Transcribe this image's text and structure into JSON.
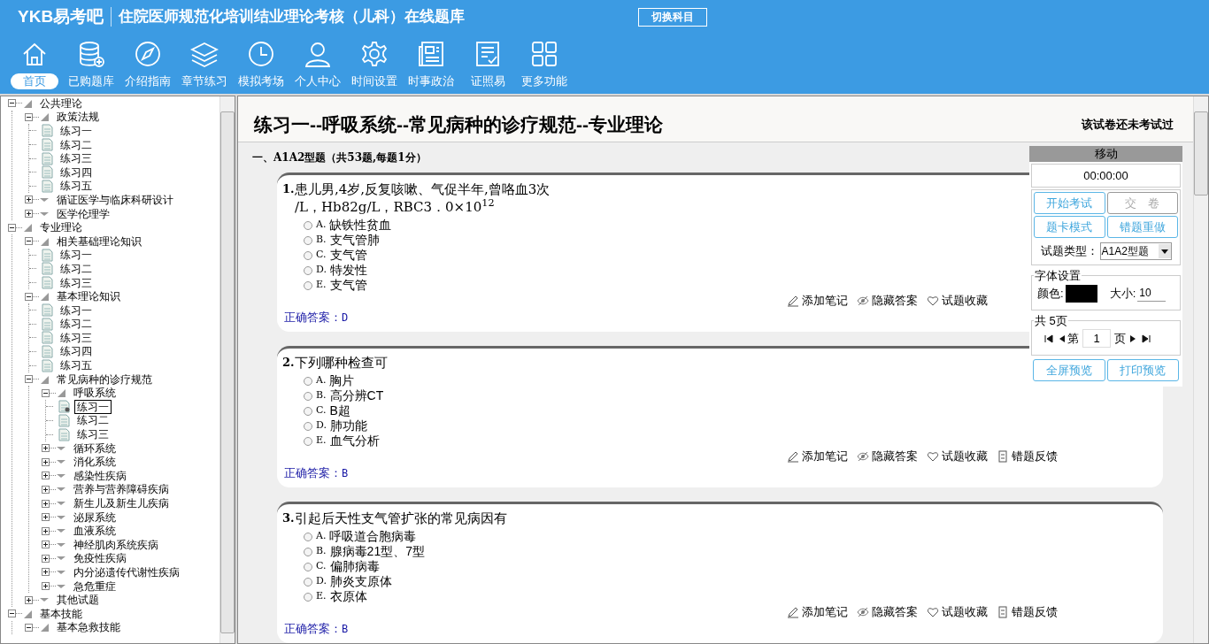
{
  "header": {
    "logo": "YKB易考吧",
    "title": "住院医师规范化培训结业理论考核（儿科）在线题库",
    "switch_button": "切换科目"
  },
  "nav": [
    {
      "label": "首页",
      "kind": "home",
      "selected": true
    },
    {
      "label": "已购题库",
      "kind": "database",
      "selected": false
    },
    {
      "label": "介绍指南",
      "kind": "compass",
      "selected": false
    },
    {
      "label": "章节练习",
      "kind": "layers",
      "selected": false
    },
    {
      "label": "模拟考场",
      "kind": "clock",
      "selected": false
    },
    {
      "label": "个人中心",
      "kind": "user",
      "selected": false
    },
    {
      "label": "时间设置",
      "kind": "gear",
      "selected": false
    },
    {
      "label": "时事政治",
      "kind": "news",
      "selected": false
    },
    {
      "label": "证照易",
      "kind": "checklist",
      "selected": false
    },
    {
      "label": "更多功能",
      "kind": "grid",
      "selected": false
    }
  ],
  "tree": [
    {
      "label": "公共理论",
      "expanded": true,
      "children": [
        {
          "label": "政策法规",
          "expanded": true,
          "children": [
            {
              "label": "练习一",
              "selected": false
            },
            {
              "label": "练习二",
              "selected": false
            },
            {
              "label": "练习三",
              "selected": false
            },
            {
              "label": "练习四",
              "selected": false
            },
            {
              "label": "练习五",
              "selected": false
            }
          ]
        },
        {
          "label": "循证医学与临床科研设计",
          "expanded": false
        },
        {
          "label": "医学伦理学",
          "expanded": false
        }
      ]
    },
    {
      "label": "专业理论",
      "expanded": true,
      "children": [
        {
          "label": "相关基础理论知识",
          "expanded": true,
          "children": [
            {
              "label": "练习一",
              "selected": false
            },
            {
              "label": "练习二",
              "selected": false
            },
            {
              "label": "练习三",
              "selected": false
            }
          ]
        },
        {
          "label": "基本理论知识",
          "expanded": true,
          "children": [
            {
              "label": "练习一",
              "selected": false
            },
            {
              "label": "练习二",
              "selected": false
            },
            {
              "label": "练习三",
              "selected": false
            },
            {
              "label": "练习四",
              "selected": false
            },
            {
              "label": "练习五",
              "selected": false
            }
          ]
        },
        {
          "label": "常见病种的诊疗规范",
          "expanded": true,
          "children": [
            {
              "label": "呼吸系统",
              "expanded": true,
              "children": [
                {
                  "label": "练习一",
                  "selected": true
                },
                {
                  "label": "练习二",
                  "selected": false
                },
                {
                  "label": "练习三",
                  "selected": false
                }
              ]
            },
            {
              "label": "循环系统",
              "expanded": false
            },
            {
              "label": "消化系统",
              "expanded": false
            },
            {
              "label": "感染性疾病",
              "expanded": false
            },
            {
              "label": "营养与营养障碍疾病",
              "expanded": false
            },
            {
              "label": "新生儿及新生儿疾病",
              "expanded": false
            },
            {
              "label": "泌尿系统",
              "expanded": false
            },
            {
              "label": "血液系统",
              "expanded": false
            },
            {
              "label": "神经肌肉系统疾病",
              "expanded": false
            },
            {
              "label": "免疫性疾病",
              "expanded": false
            },
            {
              "label": "内分泌遗传代谢性疾病",
              "expanded": false
            },
            {
              "label": "急危重症",
              "expanded": false
            }
          ]
        },
        {
          "label": "其他试题",
          "expanded": false
        }
      ]
    },
    {
      "label": "基本技能",
      "expanded": true,
      "children": [
        {
          "label": "基本急救技能",
          "expanded": true
        }
      ]
    }
  ],
  "paper": {
    "title": "练习一--呼吸系统--常见病种的诊疗规范--专业理论",
    "status": "该试卷还未考试过",
    "section": "一、A1A2型题（共53题,每题1分）"
  },
  "questions": [
    {
      "number": "1.",
      "stem": [
        "患儿男,4岁,反复咳嗽、气促半年,曾咯血3次",
        "/L，Hb82g/L，RBC3．0×10$^{12}$"
      ],
      "options": [
        {
          "letter": "A.",
          "text": "缺铁性贫血",
          "selected": false
        },
        {
          "letter": "B.",
          "text": "支气管肺",
          "selected": false
        },
        {
          "letter": "C.",
          "text": "支气管",
          "selected": false
        },
        {
          "letter": "D.",
          "text": "特发性",
          "selected": false
        },
        {
          "letter": "E.",
          "text": "支气管",
          "selected": false
        }
      ],
      "actions": [
        "添加笔记",
        "隐藏答案",
        "试题收藏"
      ],
      "answer_label": "正确答案：",
      "answer": "D"
    },
    {
      "number": "2.",
      "stem": [
        "下列哪种检查可"
      ],
      "options": [
        {
          "letter": "A.",
          "text": "胸片",
          "selected": false
        },
        {
          "letter": "B.",
          "text": "高分辨CT",
          "selected": false
        },
        {
          "letter": "C.",
          "text": "B超",
          "selected": false
        },
        {
          "letter": "D.",
          "text": "肺功能",
          "selected": false
        },
        {
          "letter": "E.",
          "text": "血气分析",
          "selected": false
        }
      ],
      "actions": [
        "添加笔记",
        "隐藏答案",
        "试题收藏",
        "错题反馈"
      ],
      "answer_label": "正确答案：",
      "answer": "B"
    },
    {
      "number": "3.",
      "stem": [
        "引起后天性支气管扩张的常见病因有"
      ],
      "options": [
        {
          "letter": "A.",
          "text": "呼吸道合胞病毒",
          "selected": false
        },
        {
          "letter": "B.",
          "text": "腺病毒21型、7型",
          "selected": false
        },
        {
          "letter": "C.",
          "text": "偏肺病毒",
          "selected": false
        },
        {
          "letter": "D.",
          "text": "肺炎支原体",
          "selected": false
        },
        {
          "letter": "E.",
          "text": "衣原体",
          "selected": false
        }
      ],
      "actions": [
        "添加笔记",
        "隐藏答案",
        "试题收藏",
        "错题反馈"
      ],
      "answer_label": "正确答案：",
      "answer": "B"
    }
  ],
  "panel": {
    "handle": "移动",
    "timer": "00:00:00",
    "buttons": [
      {
        "label": "开始考试",
        "disabled": false
      },
      {
        "label": "交　卷",
        "disabled": true
      },
      {
        "label": "题卡模式",
        "disabled": false
      },
      {
        "label": "错题重做",
        "disabled": false
      }
    ],
    "type_label": "试题类型：",
    "type_value": "A1A2型题",
    "font_group": "字体设置",
    "color_label": "颜色:",
    "color": "#000000",
    "size_label": "大小:",
    "size": "10",
    "pager_group": "共 5页",
    "page_prefix": "第",
    "page": "1",
    "page_suffix": "页",
    "bottom_buttons": [
      "全屏预览",
      "打印预览"
    ]
  }
}
